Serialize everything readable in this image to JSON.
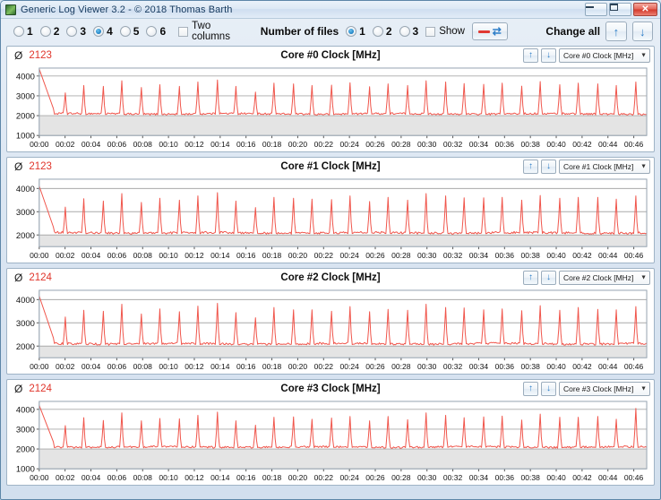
{
  "window": {
    "title": "Generic Log Viewer 3.2 - © 2018 Thomas Barth",
    "minimize_label": "",
    "maximize_label": "",
    "close_label": "✕"
  },
  "toolbar": {
    "count_options": [
      "1",
      "2",
      "3",
      "4",
      "5",
      "6"
    ],
    "count_selected": "4",
    "two_columns_label": "Two columns",
    "two_columns_checked": false,
    "number_of_files_label": "Number of files",
    "file_options": [
      "1",
      "2",
      "3"
    ],
    "file_selected": "1",
    "show_label": "Show",
    "show_checked": false,
    "line_swap_button": "swap",
    "change_all_label": "Change all",
    "up_arrow": "↑",
    "down_arrow": "↓"
  },
  "charts": [
    {
      "avg_symbol": "Ø",
      "avg_value": "2123",
      "title": "Core #0 Clock [MHz]",
      "up_arrow": "↑",
      "down_arrow": "↓",
      "combo_value": "Core #0 Clock [MHz]",
      "combo_arrow": "▼"
    },
    {
      "avg_symbol": "Ø",
      "avg_value": "2123",
      "title": "Core #1 Clock [MHz]",
      "up_arrow": "↑",
      "down_arrow": "↓",
      "combo_value": "Core #1 Clock [MHz]",
      "combo_arrow": "▼"
    },
    {
      "avg_symbol": "Ø",
      "avg_value": "2124",
      "title": "Core #2 Clock [MHz]",
      "up_arrow": "↑",
      "down_arrow": "↓",
      "combo_value": "Core #2 Clock [MHz]",
      "combo_arrow": "▼"
    },
    {
      "avg_symbol": "Ø",
      "avg_value": "2124",
      "title": "Core #3 Clock [MHz]",
      "up_arrow": "↑",
      "down_arrow": "↓",
      "combo_value": "Core #3 Clock [MHz]",
      "combo_arrow": "▼"
    }
  ],
  "chart_data": [
    {
      "type": "line",
      "title": "Core #0 Clock [MHz]",
      "xlabel": "",
      "ylabel": "MHz",
      "line_color": "#f0554b",
      "grid": true,
      "legend": "none",
      "ylim": [
        1000,
        4400
      ],
      "yticks": [
        4000,
        3000,
        2000,
        1000
      ],
      "xlim": [
        "00:00",
        "00:47"
      ],
      "xticks": [
        "00:00",
        "00:02",
        "00:04",
        "00:06",
        "00:08",
        "00:10",
        "00:12",
        "00:14",
        "00:16",
        "00:18",
        "00:20",
        "00:22",
        "00:24",
        "00:26",
        "00:28",
        "00:30",
        "00:32",
        "00:34",
        "00:36",
        "00:38",
        "00:40",
        "00:42",
        "00:44",
        "00:46"
      ],
      "baseline": 2090,
      "average": 2123,
      "spike_peaks": [
        4350,
        3150,
        3520,
        3480,
        3760,
        3420,
        3560,
        3480,
        3700,
        3800,
        3480,
        3190,
        3640,
        3600,
        3520,
        3540,
        3660,
        3460,
        3600,
        3520,
        3760,
        3700,
        3620,
        3580,
        3640,
        3490,
        3720,
        3560,
        3640,
        3600,
        3520,
        3700
      ],
      "note": "CPU core clock trace: flat ~2000-2200 MHz baseline with regular load spikes to ~3500-3800 MHz"
    },
    {
      "type": "line",
      "title": "Core #1 Clock [MHz]",
      "xlabel": "",
      "ylabel": "MHz",
      "line_color": "#f0554b",
      "grid": true,
      "legend": "none",
      "ylim": [
        1500,
        4400
      ],
      "yticks": [
        4000,
        3000,
        2000
      ],
      "xlim": [
        "00:00",
        "00:47"
      ],
      "xticks": [
        "00:00",
        "00:02",
        "00:04",
        "00:06",
        "00:08",
        "00:10",
        "00:12",
        "00:14",
        "00:16",
        "00:18",
        "00:20",
        "00:22",
        "00:24",
        "00:26",
        "00:28",
        "00:30",
        "00:32",
        "00:34",
        "00:36",
        "00:38",
        "00:40",
        "00:42",
        "00:44",
        "00:46"
      ],
      "baseline": 2090,
      "average": 2123,
      "spike_peaks": [
        4100,
        3200,
        3560,
        3460,
        3780,
        3400,
        3580,
        3500,
        3680,
        3820,
        3460,
        3180,
        3620,
        3580,
        3540,
        3520,
        3680,
        3440,
        3620,
        3500,
        3780,
        3680,
        3600,
        3600,
        3620,
        3500,
        3700,
        3580,
        3620,
        3620,
        3540,
        3680
      ],
      "note": "CPU core clock trace: flat ~2000-2200 MHz baseline with regular load spikes"
    },
    {
      "type": "line",
      "title": "Core #2 Clock [MHz]",
      "xlabel": "",
      "ylabel": "MHz",
      "line_color": "#f0554b",
      "grid": true,
      "legend": "none",
      "ylim": [
        1500,
        4400
      ],
      "yticks": [
        4000,
        3000,
        2000
      ],
      "xlim": [
        "00:00",
        "00:47"
      ],
      "xticks": [
        "00:00",
        "00:02",
        "00:04",
        "00:06",
        "00:08",
        "00:10",
        "00:12",
        "00:14",
        "00:16",
        "00:18",
        "00:20",
        "00:22",
        "00:24",
        "00:26",
        "00:28",
        "00:30",
        "00:32",
        "00:34",
        "00:36",
        "00:38",
        "00:40",
        "00:42",
        "00:44",
        "00:46"
      ],
      "baseline": 2100,
      "average": 2124,
      "spike_peaks": [
        4150,
        3250,
        3540,
        3500,
        3800,
        3380,
        3600,
        3480,
        3720,
        3840,
        3440,
        3220,
        3660,
        3560,
        3560,
        3500,
        3700,
        3480,
        3580,
        3540,
        3800,
        3660,
        3640,
        3560,
        3600,
        3520,
        3740,
        3540,
        3660,
        3580,
        3560,
        3700
      ],
      "note": "CPU core clock trace: flat ~2000-2200 MHz baseline with regular load spikes"
    },
    {
      "type": "line",
      "title": "Core #3 Clock [MHz]",
      "xlabel": "",
      "ylabel": "MHz",
      "line_color": "#f0554b",
      "grid": true,
      "legend": "none",
      "ylim": [
        1000,
        4400
      ],
      "yticks": [
        4000,
        3000,
        2000,
        1000
      ],
      "xlim": [
        "00:00",
        "00:47"
      ],
      "xticks": [
        "00:00",
        "00:02",
        "00:04",
        "00:06",
        "00:08",
        "00:10",
        "00:12",
        "00:14",
        "00:16",
        "00:18",
        "00:20",
        "00:22",
        "00:24",
        "00:26",
        "00:28",
        "00:30",
        "00:32",
        "00:34",
        "00:36",
        "00:38",
        "00:40",
        "00:42",
        "00:44",
        "00:46"
      ],
      "baseline": 2100,
      "average": 2124,
      "spike_peaks": [
        4200,
        3180,
        3580,
        3440,
        3820,
        3420,
        3540,
        3520,
        3700,
        3860,
        3420,
        3200,
        3600,
        3620,
        3500,
        3560,
        3640,
        3420,
        3640,
        3480,
        3820,
        3700,
        3580,
        3620,
        3660,
        3460,
        3760,
        3600,
        3600,
        3640,
        3500,
        4050
      ],
      "note": "CPU core clock trace: flat ~2000-2200 MHz baseline with regular load spikes"
    }
  ]
}
